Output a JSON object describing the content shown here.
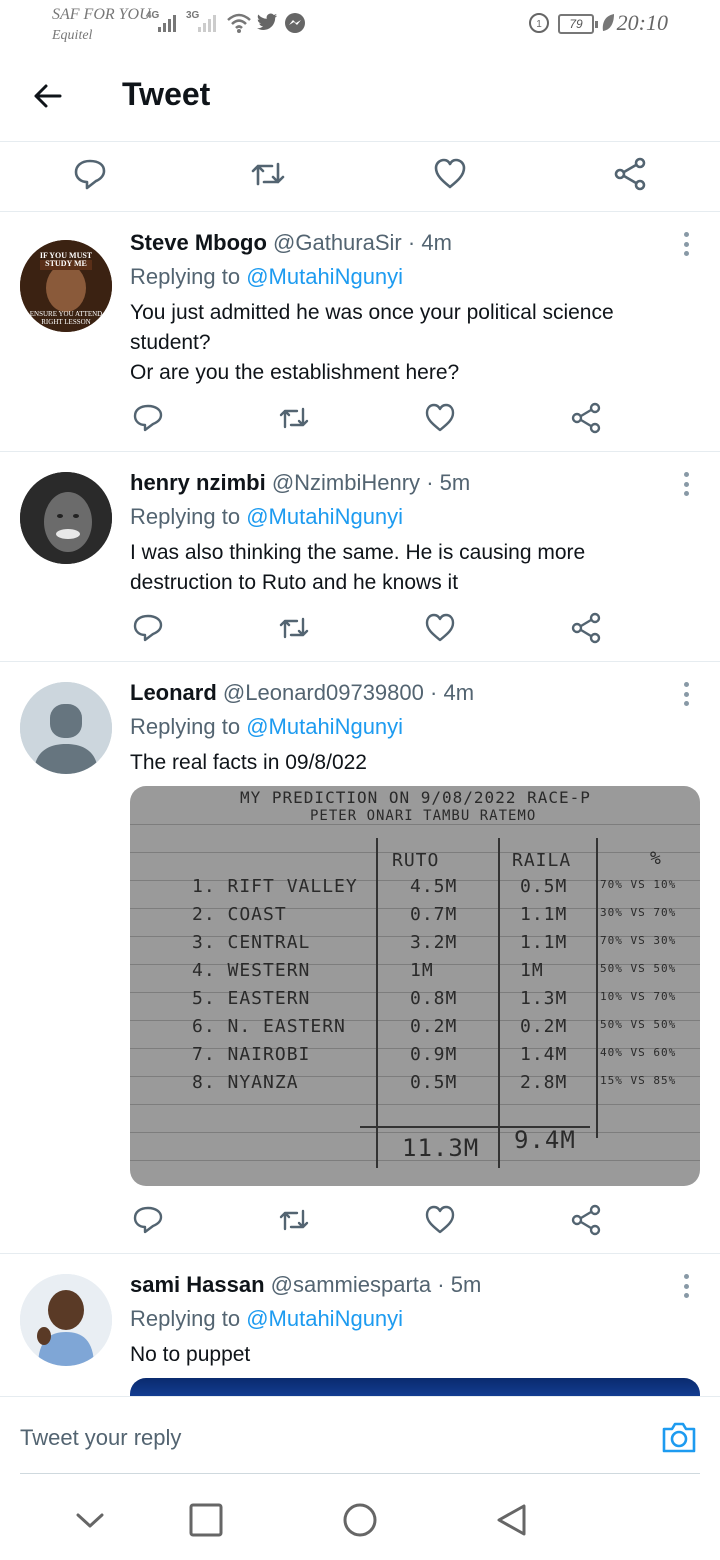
{
  "status_bar": {
    "carrier_primary": "SAF FOR YOU",
    "carrier_secondary": "Equitel",
    "network_1": "4G",
    "network_2": "3G",
    "battery": "79",
    "time": "20:10"
  },
  "header": {
    "title": "Tweet"
  },
  "replies": [
    {
      "name": "Steve Mbogo",
      "handle": "@GathuraSir",
      "time": "4m",
      "replying_prefix": "Replying to",
      "replying_to": "@MutahiNgunyi",
      "text_lines": [
        "You just admitted he was once your political science student?",
        "Or are you the establishment here?"
      ],
      "avatar_text_top": "IF YOU MUST STUDY ME",
      "avatar_text_bottom": "ENSURE YOU ATTEND RIGHT LESSON"
    },
    {
      "name": "henry nzimbi",
      "handle": "@NzimbiHenry",
      "time": "5m",
      "replying_prefix": "Replying to",
      "replying_to": "@MutahiNgunyi",
      "text_lines": [
        "I was also thinking the same. He is causing more destruction to Ruto and he knows it"
      ]
    },
    {
      "name": "Leonard",
      "handle": "@Leonard09739800",
      "time": "4m",
      "replying_prefix": "Replying to",
      "replying_to": "@MutahiNgunyi",
      "text_lines": [
        "The real facts in 09/8/022"
      ],
      "photo": {
        "title_1": "MY PREDICTION ON 9/08/2022 RACE-P",
        "title_2": "PETER ONARI TAMBU RATEMO",
        "col_ruto": "RUTO",
        "col_raila": "RAILA",
        "col_pct": "%",
        "rows": [
          {
            "region": "1. RIFT VALLEY",
            "ruto": "4.5M",
            "raila": "0.5M",
            "pct": "70% VS 10%"
          },
          {
            "region": "2. COAST",
            "ruto": "0.7M",
            "raila": "1.1M",
            "pct": "30% VS 70%"
          },
          {
            "region": "3. CENTRAL",
            "ruto": "3.2M",
            "raila": "1.1M",
            "pct": "70% VS 30%"
          },
          {
            "region": "4. WESTERN",
            "ruto": "1M",
            "raila": "1M",
            "pct": "50% VS 50%"
          },
          {
            "region": "5. EASTERN",
            "ruto": "0.8M",
            "raila": "1.3M",
            "pct": "10% VS 70%"
          },
          {
            "region": "6. N. EASTERN",
            "ruto": "0.2M",
            "raila": "0.2M",
            "pct": "50% VS 50%"
          },
          {
            "region": "7. NAIROBI",
            "ruto": "0.9M",
            "raila": "1.4M",
            "pct": "40% VS 60%"
          },
          {
            "region": "8. NYANZA",
            "ruto": "0.5M",
            "raila": "2.8M",
            "pct": "15% VS 85%"
          }
        ],
        "total_ruto": "11.3M",
        "total_raila": "9.4M"
      }
    },
    {
      "name": "sami Hassan",
      "handle": "@sammiesparta",
      "time": "5m",
      "replying_prefix": "Replying to",
      "replying_to": "@MutahiNgunyi",
      "text_lines": [
        "No to puppet"
      ]
    }
  ],
  "composer": {
    "placeholder": "Tweet your reply"
  },
  "colors": {
    "accent": "#1d9bf0",
    "icon_gray": "#536471",
    "divider": "#e6ecf0"
  },
  "icons": {
    "reply": "reply-icon",
    "retweet": "retweet-icon",
    "like": "heart-icon",
    "share": "share-icon"
  }
}
